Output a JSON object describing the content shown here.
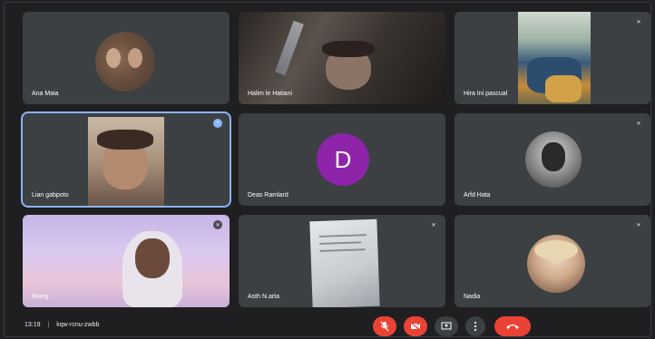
{
  "participants": [
    {
      "name": "Ana Maia"
    },
    {
      "name": "Halim le Hatiani"
    },
    {
      "name": "Hira Ini pascual"
    },
    {
      "name": "Lian gabpoto"
    },
    {
      "name": "Deas Ramlard"
    },
    {
      "name": "Arfd Hata"
    },
    {
      "name": "Riang"
    },
    {
      "name": "Asth N.arta"
    },
    {
      "name": "Nadia"
    }
  ],
  "letter_avatar": {
    "letter": "D",
    "color": "#8e24aa"
  },
  "bottom_bar": {
    "time": "13:19",
    "separator": "|",
    "meeting_code": "kqw-rcnu-zwbb"
  },
  "controls": [
    {
      "icon": "mic-off-icon",
      "color": "#ea4335"
    },
    {
      "icon": "camera-off-icon",
      "color": "#ea4335"
    },
    {
      "icon": "present-screen-icon",
      "color": "#3c4043"
    },
    {
      "icon": "more-options-icon",
      "color": "#3c4043"
    },
    {
      "icon": "hang-up-icon",
      "color": "#ea4335"
    }
  ]
}
